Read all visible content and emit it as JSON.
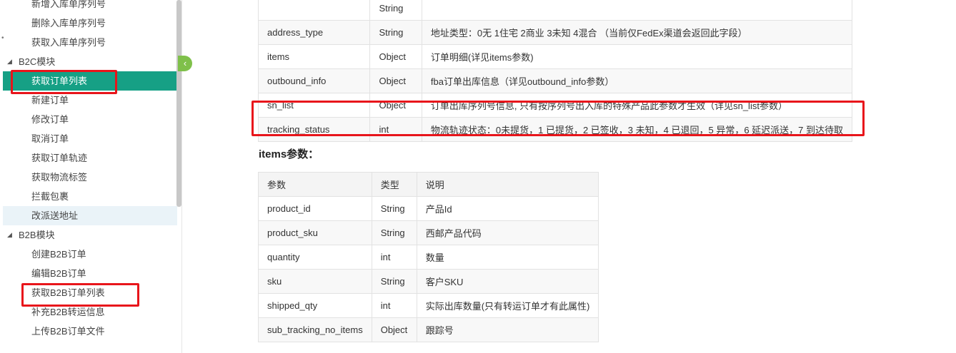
{
  "sidebar": {
    "items_top": [
      {
        "label": "新增入库单序列号"
      },
      {
        "label": "删除入库单序列号"
      },
      {
        "label": "获取入库单序列号"
      }
    ],
    "group_b2c": "B2C模块",
    "items_b2c": [
      {
        "label": "获取订单列表"
      },
      {
        "label": "新建订单"
      },
      {
        "label": "修改订单"
      },
      {
        "label": "取消订单"
      },
      {
        "label": "获取订单轨迹"
      },
      {
        "label": "获取物流标签"
      },
      {
        "label": "拦截包裹"
      },
      {
        "label": "改派送地址"
      }
    ],
    "group_b2b": "B2B模块",
    "items_b2b": [
      {
        "label": "创建B2B订单"
      },
      {
        "label": "编辑B2B订单"
      },
      {
        "label": "获取B2B订单列表"
      },
      {
        "label": "补充B2B转运信息"
      },
      {
        "label": "上传B2B订单文件"
      }
    ],
    "collapse_icon": "‹"
  },
  "main_table": {
    "rows": [
      {
        "name": "",
        "type": "String",
        "desc": ""
      },
      {
        "name": "address_type",
        "type": "String",
        "desc": "地址类型：0无 1住宅 2商业 3未知 4混合 （当前仅FedEx渠道会返回此字段）"
      },
      {
        "name": "items",
        "type": "Object",
        "desc": "订单明细(详见items参数)"
      },
      {
        "name": "outbound_info",
        "type": "Object",
        "desc": "fba订单出库信息（详见outbound_info参数）"
      },
      {
        "name": "sn_list",
        "type": "Object",
        "desc": "订单出库序列号信息, 只有按序列号出入库的特殊产品此参数才生效（详见sn_list参数）"
      },
      {
        "name": "tracking_status",
        "type": "int",
        "desc": "物流轨迹状态：0未提货，1 已提货，2 已签收，3 未知，4 已退回，5 异常，6 延迟派送，7 到达待取"
      }
    ]
  },
  "items_section": {
    "heading": "items参数：",
    "headers": [
      "参数",
      "类型",
      "说明"
    ],
    "rows": [
      {
        "name": "product_id",
        "type": "String",
        "desc": "产品Id"
      },
      {
        "name": "product_sku",
        "type": "String",
        "desc": "西邮产品代码"
      },
      {
        "name": "quantity",
        "type": "int",
        "desc": "数量"
      },
      {
        "name": "sku",
        "type": "String",
        "desc": "客户SKU"
      },
      {
        "name": "shipped_qty",
        "type": "int",
        "desc": "实际出库数量(只有转运订单才有此属性)"
      },
      {
        "name": "sub_tracking_no_items",
        "type": "Object",
        "desc": "跟踪号"
      }
    ]
  },
  "colors": {
    "accent": "#16a085",
    "highlight": "#e8151b",
    "collapse": "#7fc04a"
  }
}
